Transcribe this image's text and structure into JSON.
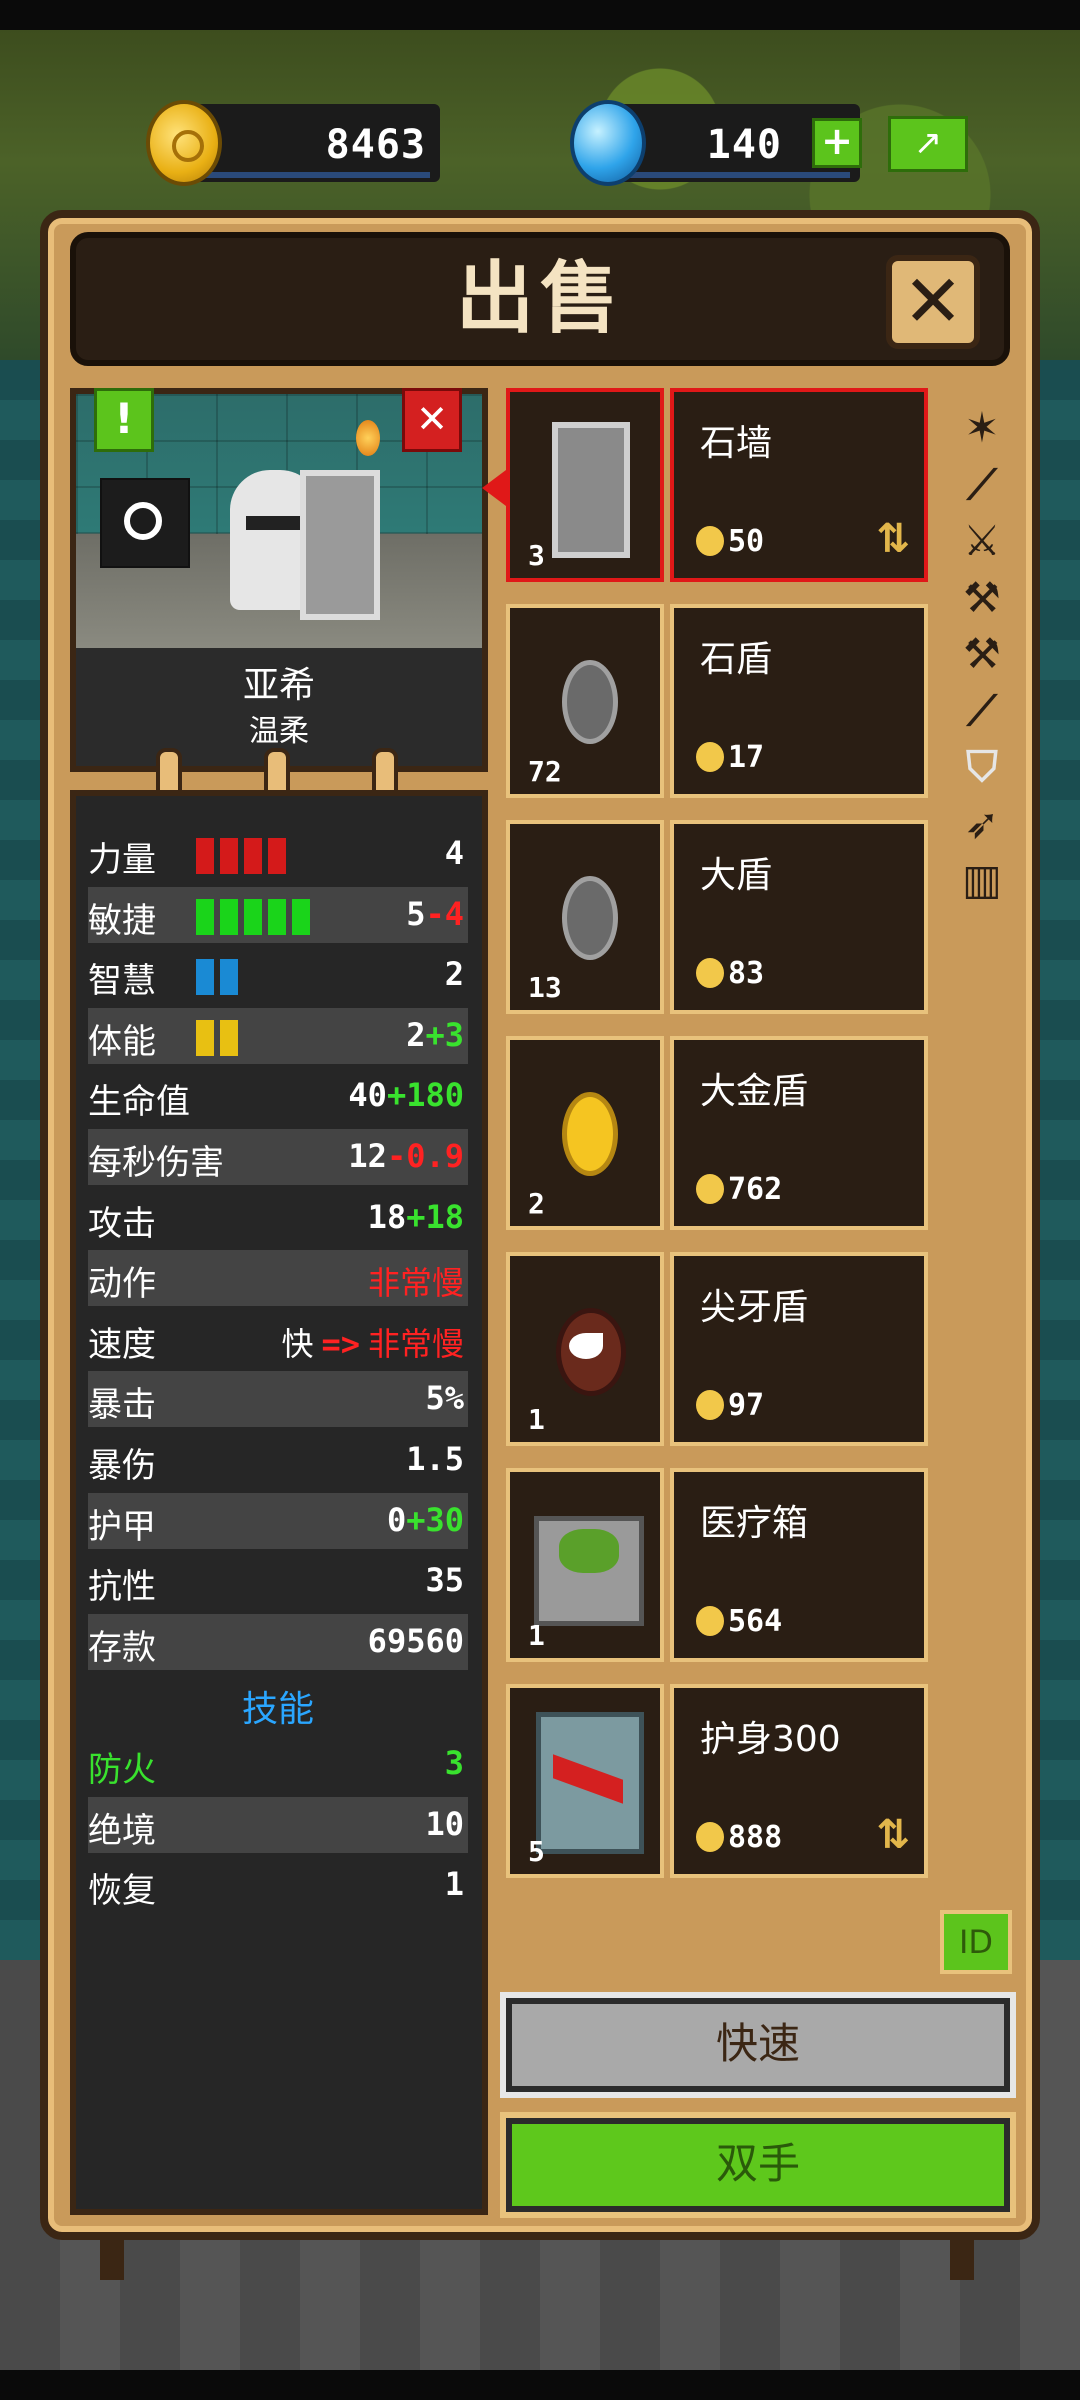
{
  "currency": {
    "coins": "8463",
    "gems": "140",
    "add_label": "+",
    "share_icon": "share-icon"
  },
  "dialog": {
    "title": "出售",
    "close_label": "✕"
  },
  "hero": {
    "name": "亚希",
    "trait": "温柔",
    "alert_label": "!",
    "dismiss_label": "✕"
  },
  "stats": [
    {
      "label": "力量",
      "value": "4",
      "bar_color": "#d41a1a",
      "bar_count": 4
    },
    {
      "label": "敏捷",
      "value": "5",
      "mod": "-4",
      "bar_color": "#1ad41a",
      "bar_count": 5
    },
    {
      "label": "智慧",
      "value": "2",
      "bar_color": "#1a8ad4",
      "bar_count": 2
    },
    {
      "label": "体能",
      "value": "2",
      "mod": "+3",
      "bar_color": "#e8c012",
      "bar_count": 2
    },
    {
      "label": "生命值",
      "value": "40",
      "mod": "+180"
    },
    {
      "label": "每秒伤害",
      "value": "12",
      "mod": "-0.9"
    },
    {
      "label": "攻击",
      "value": "18",
      "mod": "+18"
    },
    {
      "label": "动作",
      "value": "非常慢"
    },
    {
      "label": "速度",
      "value": "快",
      "arrow": "=>",
      "mod": "非常慢"
    },
    {
      "label": "暴击",
      "value": "5%"
    },
    {
      "label": "暴伤",
      "value": "1.5"
    },
    {
      "label": "护甲",
      "value": "0",
      "mod": "+30"
    },
    {
      "label": "抗性",
      "value": "35"
    },
    {
      "label": "存款",
      "value": "69560"
    }
  ],
  "skills": {
    "title": "技能",
    "items": [
      {
        "label": "防火",
        "value": "3"
      },
      {
        "label": "绝境",
        "value": "10"
      },
      {
        "label": "恢复",
        "value": "1"
      }
    ]
  },
  "items": [
    {
      "name": "石墙",
      "qty": "3",
      "price": "50",
      "swap": true,
      "art": "stonewall"
    },
    {
      "name": "石盾",
      "qty": "72",
      "price": "17",
      "art": "round-shield"
    },
    {
      "name": "大盾",
      "qty": "13",
      "price": "83",
      "art": "round-shield"
    },
    {
      "name": "大金盾",
      "qty": "2",
      "price": "762",
      "art": "gold-shield"
    },
    {
      "name": "尖牙盾",
      "qty": "1",
      "price": "97",
      "art": "fang-shield"
    },
    {
      "name": "医疗箱",
      "qty": "1",
      "price": "564",
      "art": "medkit"
    },
    {
      "name": "护身300",
      "qty": "5",
      "price": "888",
      "swap": true,
      "art": "amulet"
    }
  ],
  "swap_glyph": "⇅",
  "categories": [
    "crossbow-icon",
    "dagger-icon",
    "sword-icon",
    "axe-icon",
    "hammer-icon",
    "spear-icon",
    "shield-icon",
    "bow-icon",
    "chest-icon"
  ],
  "category_glyphs": [
    "✶",
    "⟋",
    "⚔",
    "⚒",
    "⚒",
    "⟋",
    "⛉",
    "➶",
    "▥"
  ],
  "id_label": "ID",
  "buttons": {
    "quick": "快速",
    "dual": "双手"
  }
}
